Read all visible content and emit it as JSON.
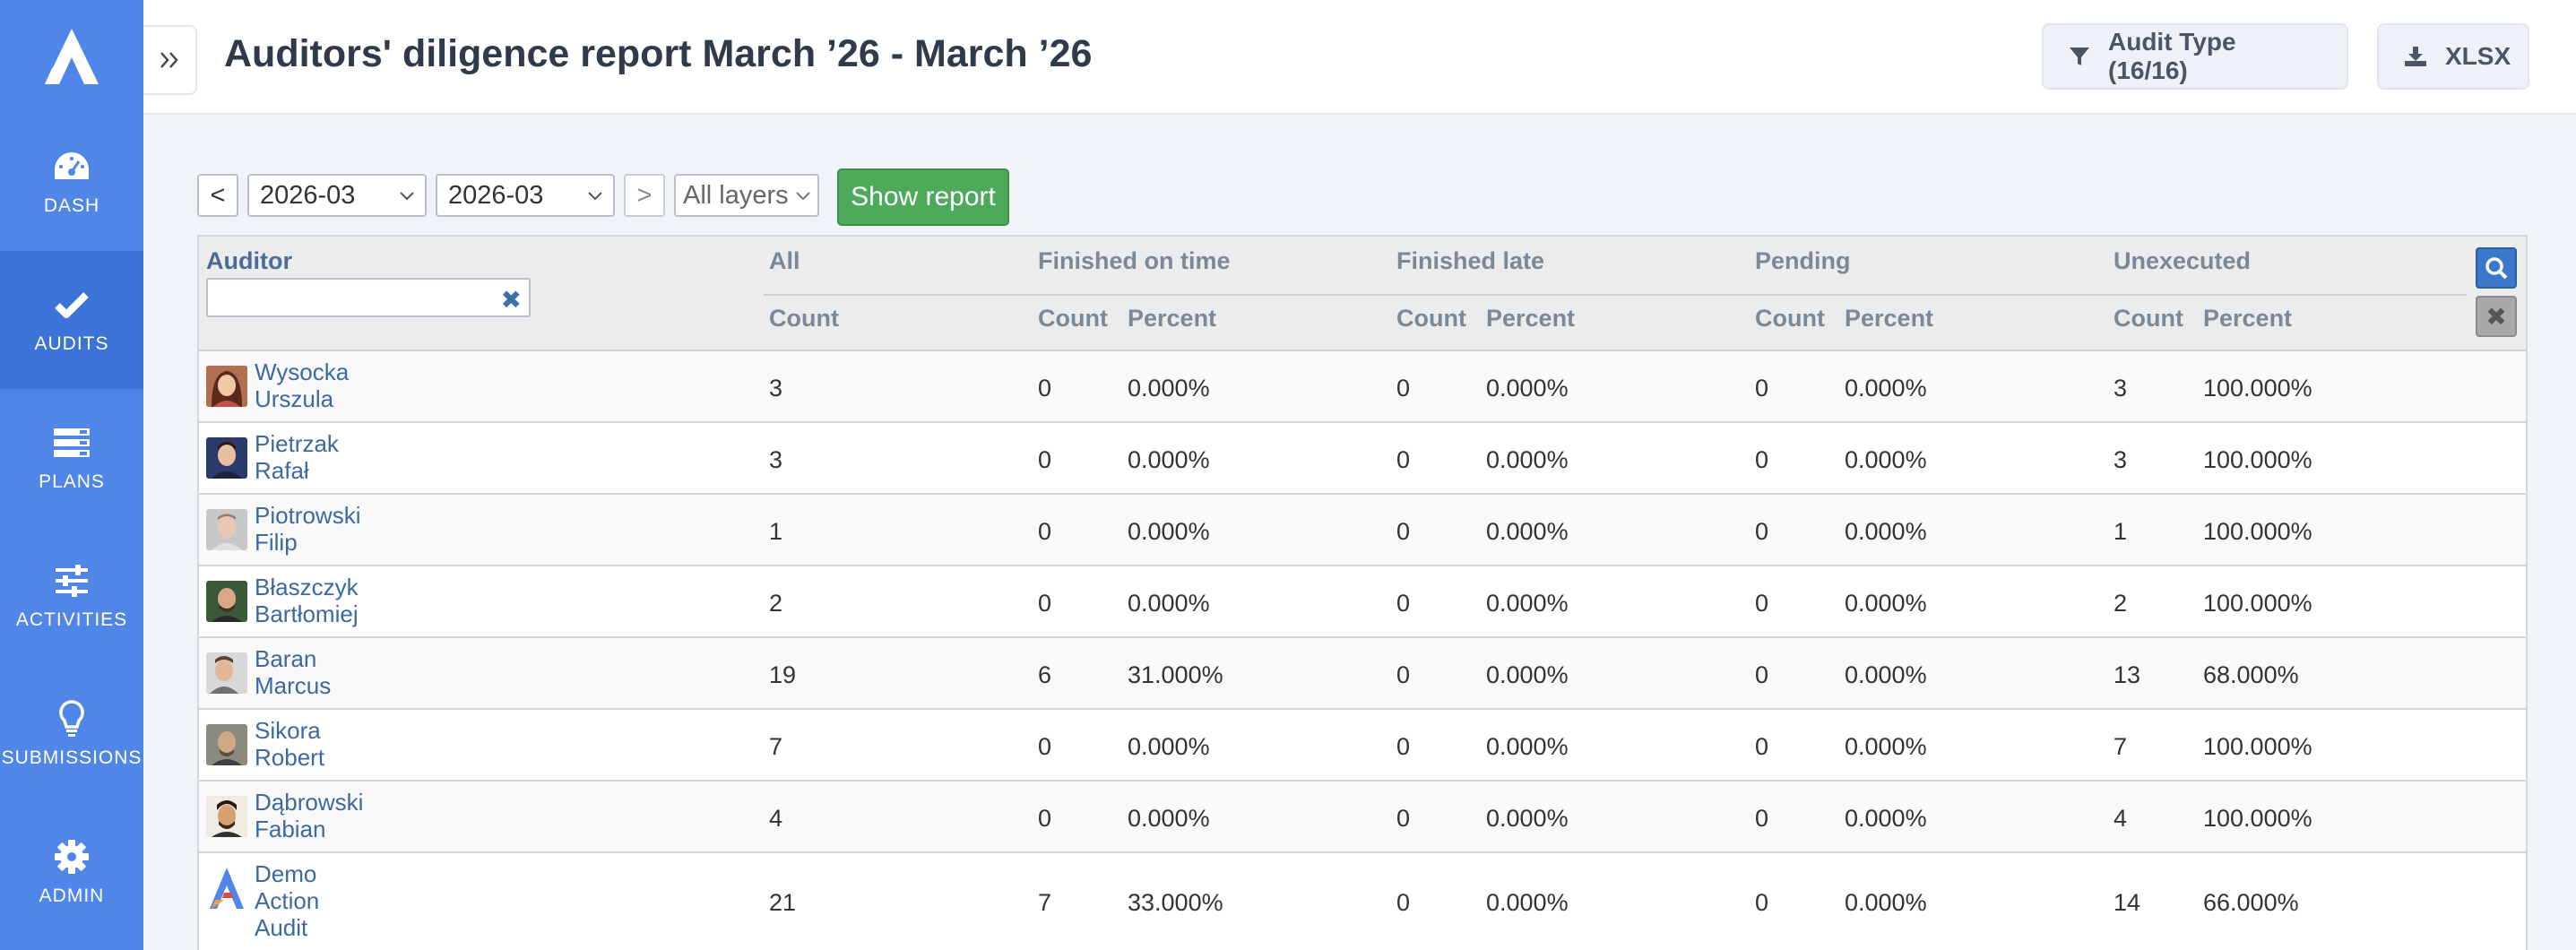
{
  "app": {
    "brand_color": "#4f86e8",
    "accent_color": "#3b73d6"
  },
  "sidebar": {
    "items": [
      {
        "label": "DASH",
        "icon": "dashboard-icon"
      },
      {
        "label": "AUDITS",
        "icon": "check-icon",
        "active": true
      },
      {
        "label": "PLANS",
        "icon": "plans-icon"
      },
      {
        "label": "ACTIVITIES",
        "icon": "sliders-icon"
      },
      {
        "label": "SUBMISSIONS",
        "icon": "lightbulb-icon"
      },
      {
        "label": "ADMIN",
        "icon": "gear-icon"
      }
    ]
  },
  "header": {
    "title": "Auditors' diligence report March ’26 - March ’26",
    "audit_type_label": "Audit Type (16/16)",
    "export_label": "XLSX"
  },
  "filters": {
    "prev_label": "<",
    "next_label": ">",
    "from_value": "2026-03",
    "to_value": "2026-03",
    "layers_value": "All layers",
    "show_report_label": "Show report"
  },
  "table": {
    "headers": {
      "auditor": "Auditor",
      "all": "All",
      "finished_on_time": "Finished on time",
      "finished_late": "Finished late",
      "pending": "Pending",
      "unexecuted": "Unexecuted",
      "count": "Count",
      "percent": "Percent"
    },
    "auditor_filter_value": "",
    "clear_symbol": "✖",
    "rows": [
      {
        "last": "Wysocka",
        "first": "Urszula",
        "all": "3",
        "ot_count": "0",
        "ot_pct": "0.000%",
        "late_count": "0",
        "late_pct": "0.000%",
        "pend_count": "0",
        "pend_pct": "0.000%",
        "unex_count": "3",
        "unex_pct": "100.000%"
      },
      {
        "last": "Pietrzak",
        "first": "Rafał",
        "all": "3",
        "ot_count": "0",
        "ot_pct": "0.000%",
        "late_count": "0",
        "late_pct": "0.000%",
        "pend_count": "0",
        "pend_pct": "0.000%",
        "unex_count": "3",
        "unex_pct": "100.000%"
      },
      {
        "last": "Piotrowski",
        "first": "Filip",
        "all": "1",
        "ot_count": "0",
        "ot_pct": "0.000%",
        "late_count": "0",
        "late_pct": "0.000%",
        "pend_count": "0",
        "pend_pct": "0.000%",
        "unex_count": "1",
        "unex_pct": "100.000%"
      },
      {
        "last": "Błaszczyk",
        "first": "Bartłomiej",
        "all": "2",
        "ot_count": "0",
        "ot_pct": "0.000%",
        "late_count": "0",
        "late_pct": "0.000%",
        "pend_count": "0",
        "pend_pct": "0.000%",
        "unex_count": "2",
        "unex_pct": "100.000%"
      },
      {
        "last": "Baran",
        "first": "Marcus",
        "all": "19",
        "ot_count": "6",
        "ot_pct": "31.000%",
        "late_count": "0",
        "late_pct": "0.000%",
        "pend_count": "0",
        "pend_pct": "0.000%",
        "unex_count": "13",
        "unex_pct": "68.000%"
      },
      {
        "last": "Sikora",
        "first": "Robert",
        "all": "7",
        "ot_count": "0",
        "ot_pct": "0.000%",
        "late_count": "0",
        "late_pct": "0.000%",
        "pend_count": "0",
        "pend_pct": "0.000%",
        "unex_count": "7",
        "unex_pct": "100.000%"
      },
      {
        "last": "Dąbrowski",
        "first": "Fabian",
        "all": "4",
        "ot_count": "0",
        "ot_pct": "0.000%",
        "late_count": "0",
        "late_pct": "0.000%",
        "pend_count": "0",
        "pend_pct": "0.000%",
        "unex_count": "4",
        "unex_pct": "100.000%"
      },
      {
        "last": "Demo",
        "first": "Action",
        "third": "Audit",
        "all": "21",
        "ot_count": "7",
        "ot_pct": "33.000%",
        "late_count": "0",
        "late_pct": "0.000%",
        "pend_count": "0",
        "pend_pct": "0.000%",
        "unex_count": "14",
        "unex_pct": "66.000%"
      }
    ]
  }
}
